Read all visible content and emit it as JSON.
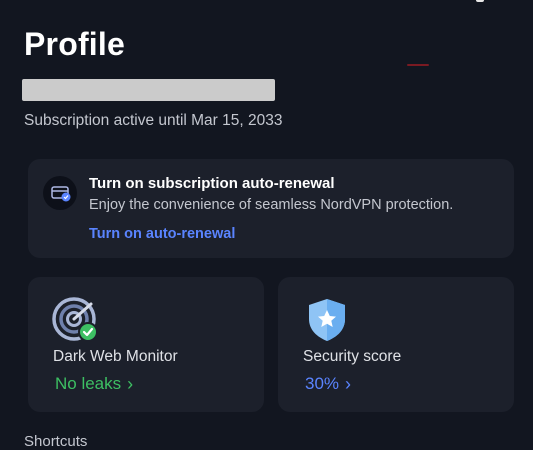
{
  "header": {
    "title": "Profile",
    "subscription_status": "Subscription active until Mar 15, 2033"
  },
  "renewal_card": {
    "icon": "auto-renew-card-icon",
    "title": "Turn on subscription auto-renewal",
    "description": "Enjoy the convenience of seamless NordVPN protection.",
    "link": "Turn on auto-renewal"
  },
  "dark_web_monitor": {
    "icon": "radar-check-icon",
    "title": "Dark Web Monitor",
    "status": "No leaks",
    "chevron": "›"
  },
  "security_score": {
    "icon": "shield-star-icon",
    "title": "Security score",
    "value": "30%",
    "chevron": "›"
  },
  "shortcuts": {
    "label": "Shortcuts"
  },
  "colors": {
    "background": "#121620",
    "card": "#1c202b",
    "accent_blue": "#5a84ff",
    "success_green": "#3dbf63"
  }
}
